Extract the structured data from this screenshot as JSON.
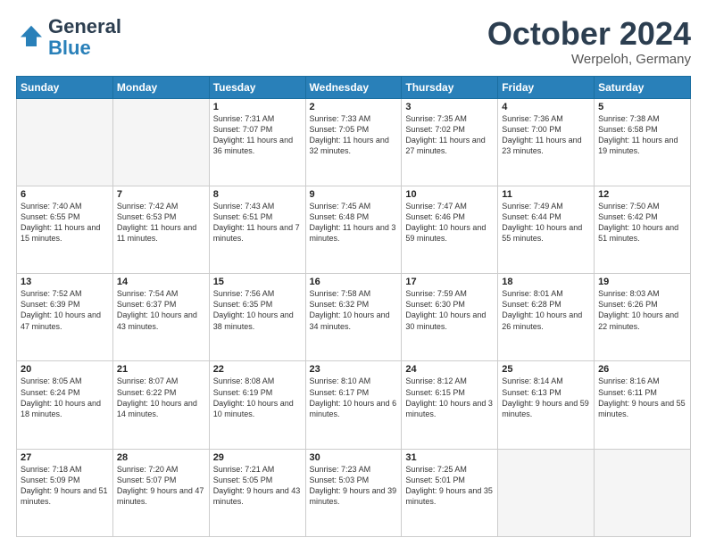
{
  "header": {
    "logo_line1": "General",
    "logo_line2": "Blue",
    "month": "October 2024",
    "location": "Werpeloh, Germany"
  },
  "weekdays": [
    "Sunday",
    "Monday",
    "Tuesday",
    "Wednesday",
    "Thursday",
    "Friday",
    "Saturday"
  ],
  "weeks": [
    [
      {
        "day": "",
        "info": ""
      },
      {
        "day": "",
        "info": ""
      },
      {
        "day": "1",
        "info": "Sunrise: 7:31 AM\nSunset: 7:07 PM\nDaylight: 11 hours and 36 minutes."
      },
      {
        "day": "2",
        "info": "Sunrise: 7:33 AM\nSunset: 7:05 PM\nDaylight: 11 hours and 32 minutes."
      },
      {
        "day": "3",
        "info": "Sunrise: 7:35 AM\nSunset: 7:02 PM\nDaylight: 11 hours and 27 minutes."
      },
      {
        "day": "4",
        "info": "Sunrise: 7:36 AM\nSunset: 7:00 PM\nDaylight: 11 hours and 23 minutes."
      },
      {
        "day": "5",
        "info": "Sunrise: 7:38 AM\nSunset: 6:58 PM\nDaylight: 11 hours and 19 minutes."
      }
    ],
    [
      {
        "day": "6",
        "info": "Sunrise: 7:40 AM\nSunset: 6:55 PM\nDaylight: 11 hours and 15 minutes."
      },
      {
        "day": "7",
        "info": "Sunrise: 7:42 AM\nSunset: 6:53 PM\nDaylight: 11 hours and 11 minutes."
      },
      {
        "day": "8",
        "info": "Sunrise: 7:43 AM\nSunset: 6:51 PM\nDaylight: 11 hours and 7 minutes."
      },
      {
        "day": "9",
        "info": "Sunrise: 7:45 AM\nSunset: 6:48 PM\nDaylight: 11 hours and 3 minutes."
      },
      {
        "day": "10",
        "info": "Sunrise: 7:47 AM\nSunset: 6:46 PM\nDaylight: 10 hours and 59 minutes."
      },
      {
        "day": "11",
        "info": "Sunrise: 7:49 AM\nSunset: 6:44 PM\nDaylight: 10 hours and 55 minutes."
      },
      {
        "day": "12",
        "info": "Sunrise: 7:50 AM\nSunset: 6:42 PM\nDaylight: 10 hours and 51 minutes."
      }
    ],
    [
      {
        "day": "13",
        "info": "Sunrise: 7:52 AM\nSunset: 6:39 PM\nDaylight: 10 hours and 47 minutes."
      },
      {
        "day": "14",
        "info": "Sunrise: 7:54 AM\nSunset: 6:37 PM\nDaylight: 10 hours and 43 minutes."
      },
      {
        "day": "15",
        "info": "Sunrise: 7:56 AM\nSunset: 6:35 PM\nDaylight: 10 hours and 38 minutes."
      },
      {
        "day": "16",
        "info": "Sunrise: 7:58 AM\nSunset: 6:32 PM\nDaylight: 10 hours and 34 minutes."
      },
      {
        "day": "17",
        "info": "Sunrise: 7:59 AM\nSunset: 6:30 PM\nDaylight: 10 hours and 30 minutes."
      },
      {
        "day": "18",
        "info": "Sunrise: 8:01 AM\nSunset: 6:28 PM\nDaylight: 10 hours and 26 minutes."
      },
      {
        "day": "19",
        "info": "Sunrise: 8:03 AM\nSunset: 6:26 PM\nDaylight: 10 hours and 22 minutes."
      }
    ],
    [
      {
        "day": "20",
        "info": "Sunrise: 8:05 AM\nSunset: 6:24 PM\nDaylight: 10 hours and 18 minutes."
      },
      {
        "day": "21",
        "info": "Sunrise: 8:07 AM\nSunset: 6:22 PM\nDaylight: 10 hours and 14 minutes."
      },
      {
        "day": "22",
        "info": "Sunrise: 8:08 AM\nSunset: 6:19 PM\nDaylight: 10 hours and 10 minutes."
      },
      {
        "day": "23",
        "info": "Sunrise: 8:10 AM\nSunset: 6:17 PM\nDaylight: 10 hours and 6 minutes."
      },
      {
        "day": "24",
        "info": "Sunrise: 8:12 AM\nSunset: 6:15 PM\nDaylight: 10 hours and 3 minutes."
      },
      {
        "day": "25",
        "info": "Sunrise: 8:14 AM\nSunset: 6:13 PM\nDaylight: 9 hours and 59 minutes."
      },
      {
        "day": "26",
        "info": "Sunrise: 8:16 AM\nSunset: 6:11 PM\nDaylight: 9 hours and 55 minutes."
      }
    ],
    [
      {
        "day": "27",
        "info": "Sunrise: 7:18 AM\nSunset: 5:09 PM\nDaylight: 9 hours and 51 minutes."
      },
      {
        "day": "28",
        "info": "Sunrise: 7:20 AM\nSunset: 5:07 PM\nDaylight: 9 hours and 47 minutes."
      },
      {
        "day": "29",
        "info": "Sunrise: 7:21 AM\nSunset: 5:05 PM\nDaylight: 9 hours and 43 minutes."
      },
      {
        "day": "30",
        "info": "Sunrise: 7:23 AM\nSunset: 5:03 PM\nDaylight: 9 hours and 39 minutes."
      },
      {
        "day": "31",
        "info": "Sunrise: 7:25 AM\nSunset: 5:01 PM\nDaylight: 9 hours and 35 minutes."
      },
      {
        "day": "",
        "info": ""
      },
      {
        "day": "",
        "info": ""
      }
    ]
  ]
}
